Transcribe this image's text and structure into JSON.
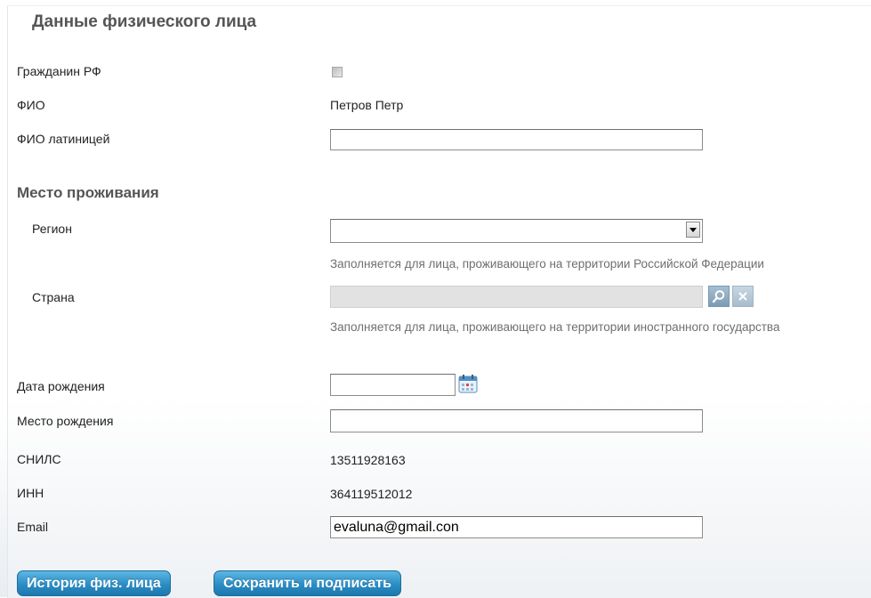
{
  "sections": {
    "person_title": "Данные физического лица",
    "residence_title": "Место проживания"
  },
  "fields": {
    "citizen": {
      "label": "Гражданин РФ",
      "checked": false
    },
    "fio": {
      "label": "ФИО",
      "value": "Петров Петр"
    },
    "fio_latin": {
      "label": "ФИО латиницей",
      "value": ""
    },
    "region": {
      "label": "Регион",
      "value": "",
      "hint": "Заполняется для лица, проживающего на территории Российской Федерации"
    },
    "country": {
      "label": "Страна",
      "value": "",
      "hint": "Заполняется для лица, проживающего на территории иностранного государства"
    },
    "birth_date": {
      "label": "Дата рождения",
      "value": ""
    },
    "birth_place": {
      "label": "Место рождения",
      "value": ""
    },
    "snils": {
      "label": "СНИЛС",
      "value": "13511928163"
    },
    "inn": {
      "label": "ИНН",
      "value": "364119512012"
    },
    "email": {
      "label": "Email",
      "value": "evaluna@gmail.con"
    }
  },
  "buttons": {
    "history": "История физ. лица",
    "save_sign": "Сохранить и подписать"
  },
  "icons": {
    "search": "search-icon",
    "clear": "close-icon",
    "calendar": "calendar-icon",
    "dropdown": "chevron-down-icon"
  },
  "colors": {
    "button": "#2b8dc4",
    "hint_text": "#6f6f6f",
    "section_title": "#555555"
  }
}
